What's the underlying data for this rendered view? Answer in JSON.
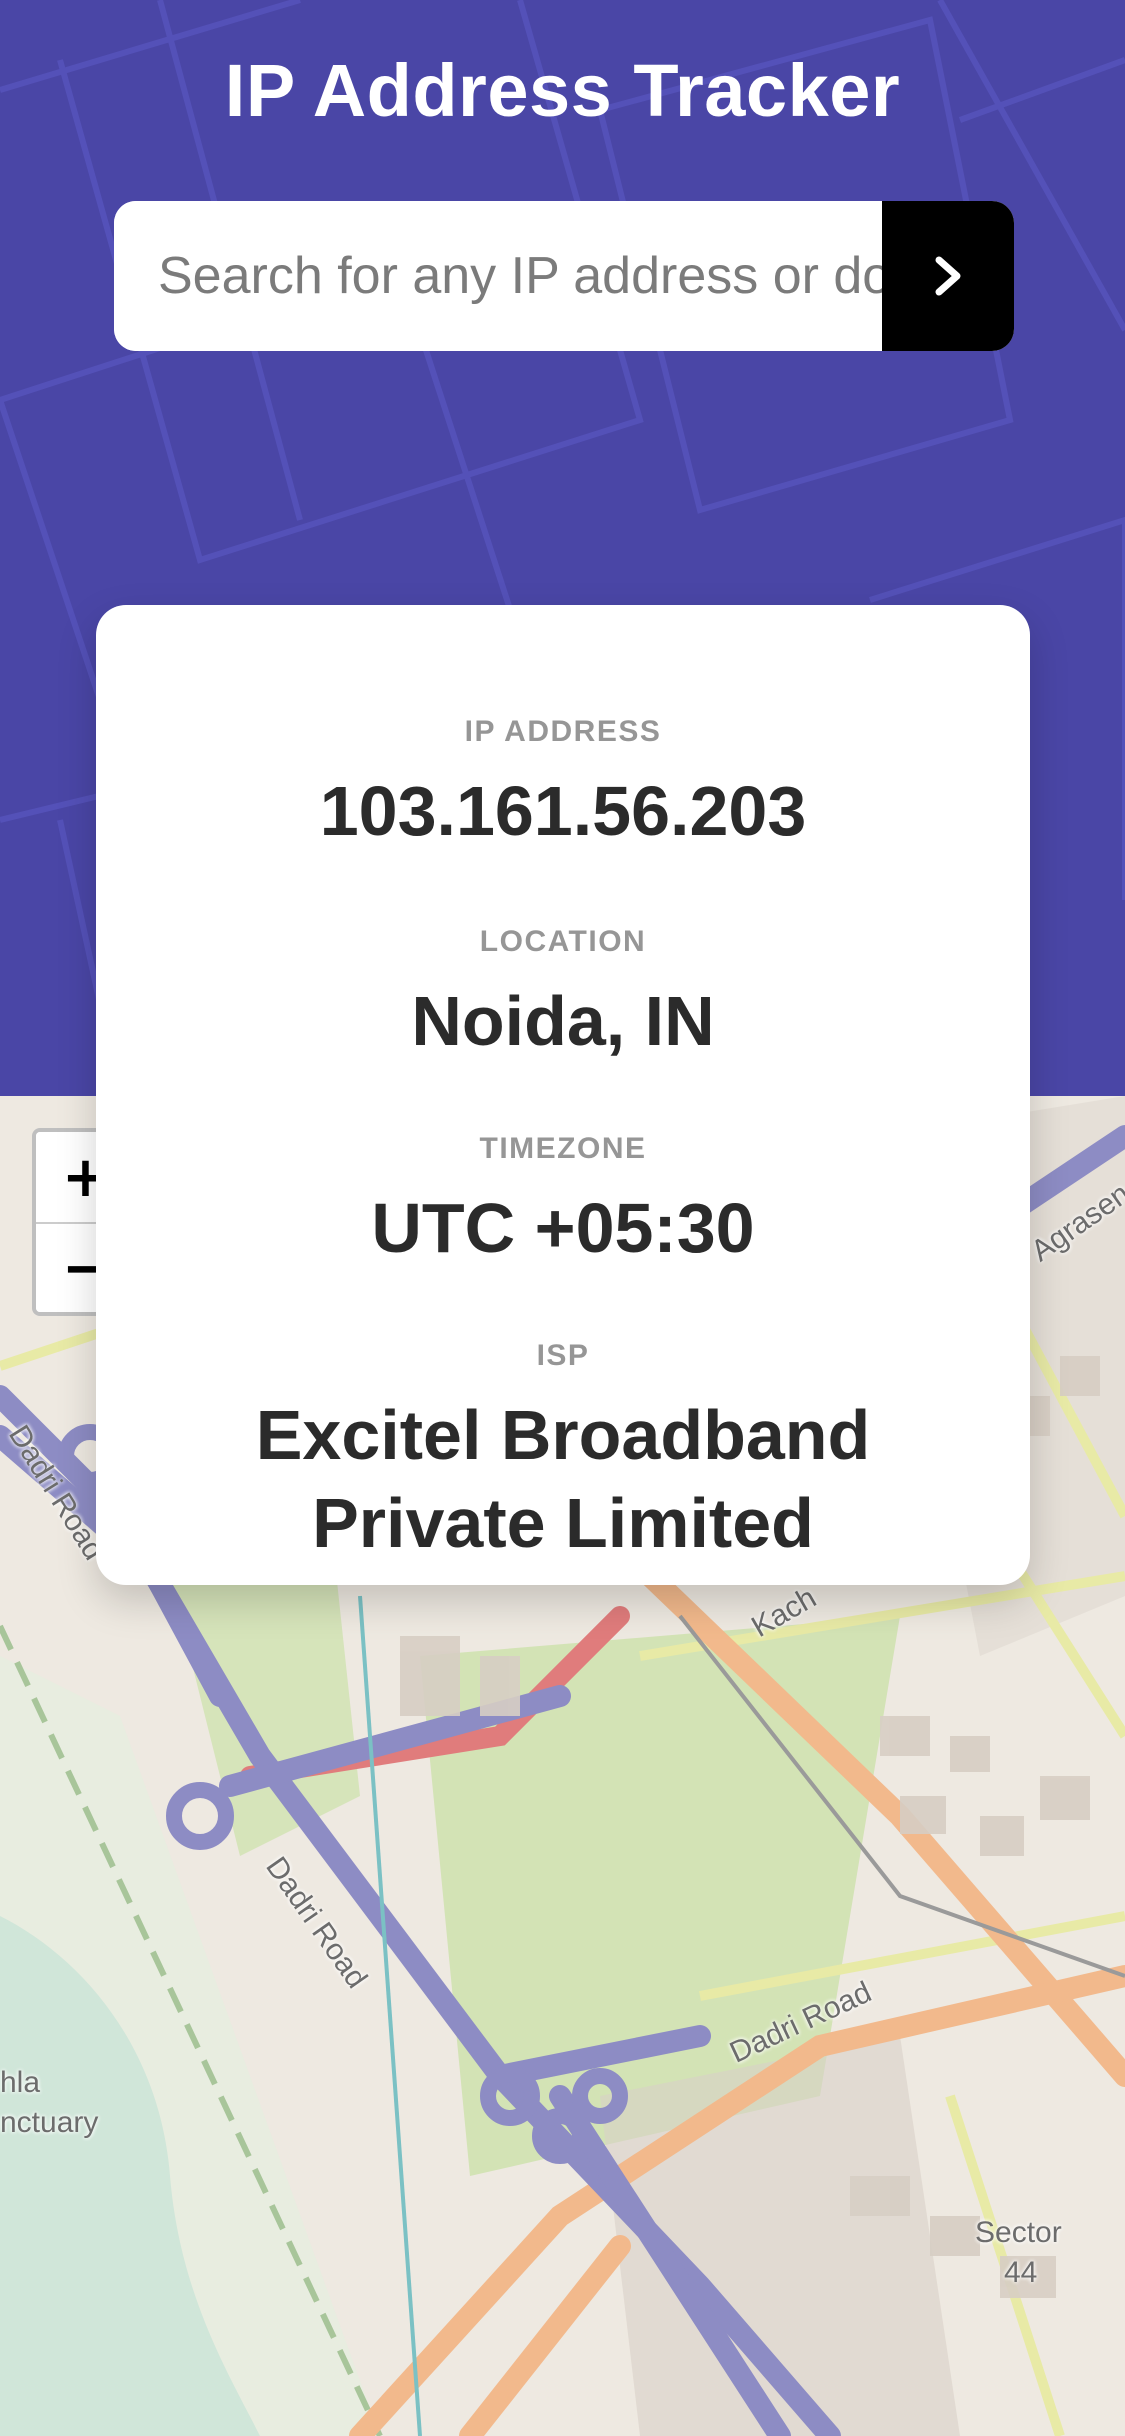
{
  "header": {
    "title": "IP Address Tracker",
    "background_color": "#4a46a6"
  },
  "search": {
    "placeholder": "Search for any IP address or domain",
    "value": "",
    "submit_icon": "chevron-right-icon"
  },
  "info": {
    "ip_label": "IP ADDRESS",
    "ip_value": "103.161.56.203",
    "location_label": "LOCATION",
    "location_value": "Noida, IN",
    "timezone_label": "TIMEZONE",
    "timezone_value": "UTC +05:30",
    "isp_label": "ISP",
    "isp_value": "Excitel Broadband Private Limited"
  },
  "map": {
    "zoom_in": "+",
    "zoom_out": "−",
    "labels": {
      "dadri_road_1": "Dadri Road",
      "dadri_road_2": "Dadri Road",
      "dadri_road_3": "Dadri Road",
      "agrasen": "Agrasen",
      "kach": "Kach",
      "hla": "hla",
      "sanctuary": "nctuary",
      "sector": "Sector",
      "sector_num": "44"
    }
  }
}
